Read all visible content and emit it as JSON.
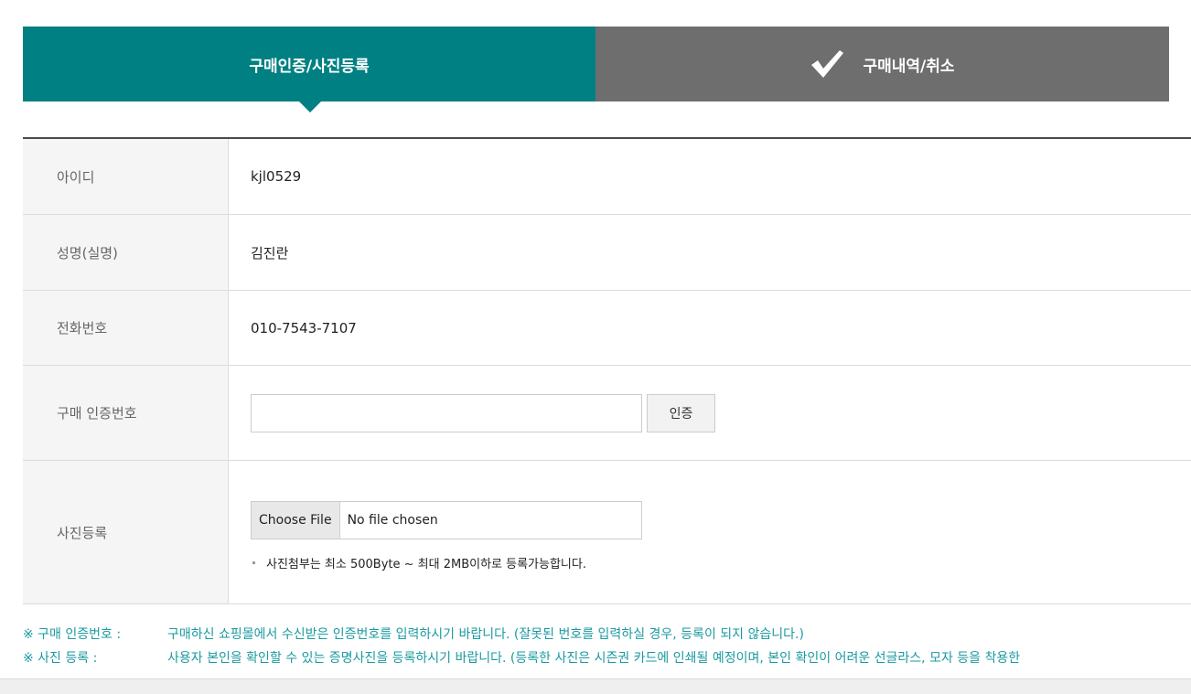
{
  "tabs": {
    "active_label": "구매인증/사진등록",
    "inactive_label": "구매내역/취소",
    "active_color": "#008082",
    "inactive_color": "#6e6e6e"
  },
  "form": {
    "rows": [
      {
        "label": "아이디",
        "value": "kjl0529"
      },
      {
        "label": "성명(실명)",
        "value": "김진란"
      },
      {
        "label": "전화번호",
        "value": "010-7543-7107"
      },
      {
        "label": "구매 인증번호",
        "value": ""
      },
      {
        "label": "사진등록",
        "value": ""
      }
    ],
    "auth_input_value": "",
    "auth_button": "인증",
    "file_choose": "Choose File",
    "file_status": "No file chosen",
    "photo_note": "사진첨부는 최소 500Byte ~ 최대 2MB이하로 등록가능합니다."
  },
  "notes": [
    {
      "label": "※ 구매 인증번호 :",
      "text": "구매하신 쇼핑몰에서 수신받은 인증번호를 입력하시기 바랍니다. (잘못된 번호를 입력하실 경우, 등록이 되지 않습니다.)"
    },
    {
      "label": "※ 사진 등록 :",
      "text": "사용자 본인을 확인할 수 있는 증명사진을 등록하시기 바랍니다. (등록한 사진은 시즌권 카드에 인쇄될 예정이며, 본인 확인이 어려운 선글라스, 모자 등을 착용한"
    }
  ],
  "icons": {
    "check": "check-icon"
  },
  "note_color": "#1a9aa0"
}
